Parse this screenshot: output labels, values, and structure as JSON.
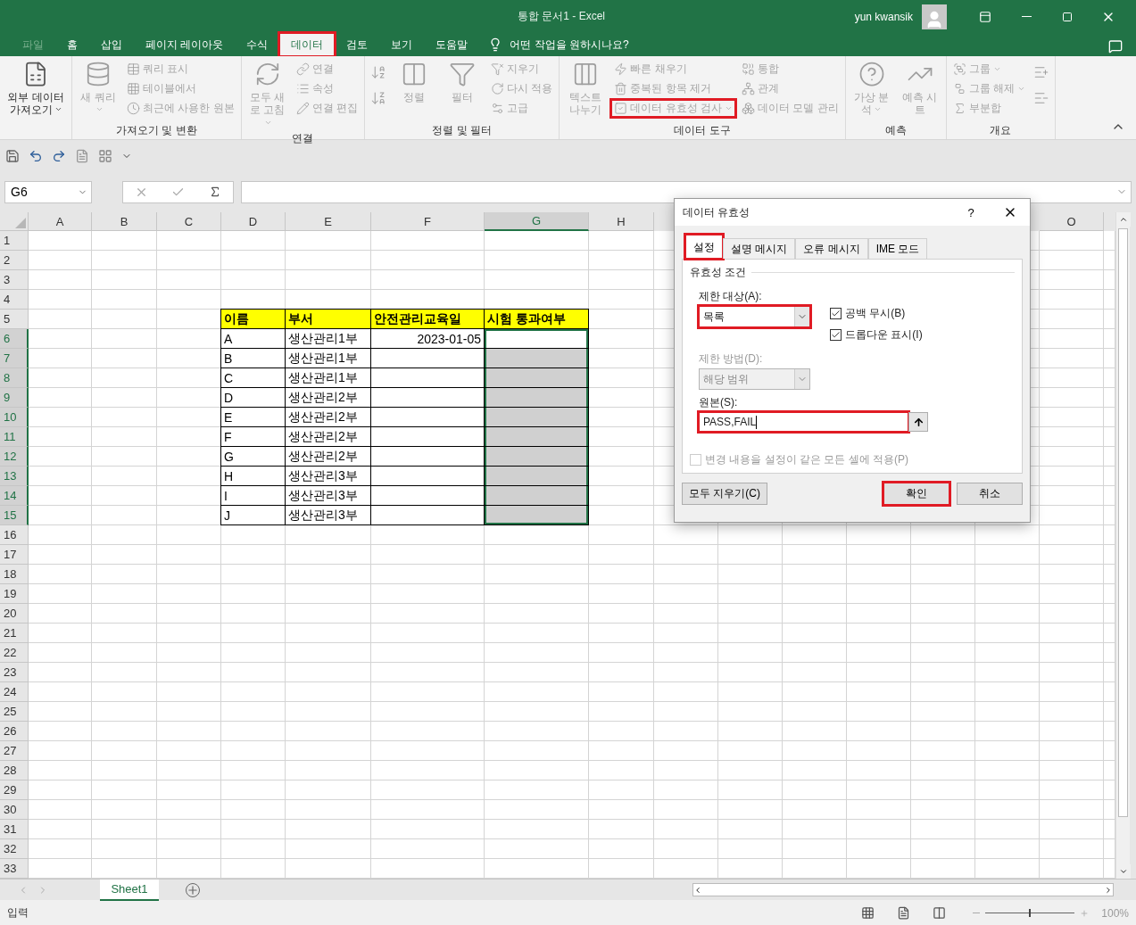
{
  "window": {
    "title": "통합 문서1  -  Excel",
    "user": "yun kwansik"
  },
  "menu_tabs": [
    {
      "label": "파일",
      "kind": "file",
      "selected": false,
      "highlighted": false
    },
    {
      "label": "홈",
      "kind": "tab",
      "selected": false,
      "highlighted": false
    },
    {
      "label": "삽입",
      "kind": "tab",
      "selected": false,
      "highlighted": false
    },
    {
      "label": "페이지 레이아웃",
      "kind": "tab",
      "selected": false,
      "highlighted": false
    },
    {
      "label": "수식",
      "kind": "tab",
      "selected": false,
      "highlighted": false
    },
    {
      "label": "데이터",
      "kind": "tab",
      "selected": true,
      "highlighted": true
    },
    {
      "label": "검토",
      "kind": "tab",
      "selected": false,
      "highlighted": false
    },
    {
      "label": "보기",
      "kind": "tab",
      "selected": false,
      "highlighted": false
    },
    {
      "label": "도움말",
      "kind": "tab",
      "selected": false,
      "highlighted": false
    }
  ],
  "tell_me": {
    "placeholder": "어떤 작업을 원하시나요?"
  },
  "ribbon": {
    "groups": [
      {
        "columns": [
          {
            "kind": "large",
            "label": "외부 데이터 가져오기",
            "disabled": false,
            "dropdown": true,
            "highlighted": false
          }
        ]
      },
      {
        "label": "가져오기 및 변환",
        "columns": [
          {
            "kind": "large",
            "label": "새 쿼리",
            "disabled": true,
            "dropdown": true,
            "highlighted": false
          },
          {
            "kind": "stack",
            "items": [
              {
                "label": "쿼리 표시",
                "disabled": true,
                "dropdown": false,
                "highlighted": false
              },
              {
                "label": "테이블에서",
                "disabled": true,
                "dropdown": false,
                "highlighted": false
              },
              {
                "label": "최근에 사용한 원본",
                "disabled": true,
                "dropdown": false,
                "highlighted": false
              }
            ]
          }
        ]
      },
      {
        "label": "연결",
        "columns": [
          {
            "kind": "large",
            "label": "모두 새로 고침",
            "disabled": true,
            "dropdown": true,
            "highlighted": false
          },
          {
            "kind": "stack",
            "items": [
              {
                "label": "연결",
                "disabled": true,
                "dropdown": false,
                "highlighted": false
              },
              {
                "label": "속성",
                "disabled": true,
                "dropdown": false,
                "highlighted": false
              },
              {
                "label": "연결 편집",
                "disabled": true,
                "dropdown": false,
                "highlighted": false
              }
            ]
          }
        ]
      },
      {
        "label": "정렬 및 필터",
        "columns": [
          {
            "kind": "icons",
            "items": [
              {
                "disabled": true
              },
              {
                "disabled": true
              }
            ]
          },
          {
            "kind": "large",
            "label": "정렬",
            "disabled": true,
            "dropdown": false,
            "highlighted": false
          },
          {
            "kind": "large",
            "label": "필터",
            "disabled": true,
            "dropdown": false,
            "highlighted": false
          },
          {
            "kind": "stack",
            "items": [
              {
                "label": "지우기",
                "disabled": true,
                "dropdown": false,
                "highlighted": false
              },
              {
                "label": "다시 적용",
                "disabled": true,
                "dropdown": false,
                "highlighted": false
              },
              {
                "label": "고급",
                "disabled": true,
                "dropdown": false,
                "highlighted": false
              }
            ]
          }
        ]
      },
      {
        "label": "데이터 도구",
        "columns": [
          {
            "kind": "large",
            "label": "텍스트 나누기",
            "disabled": true,
            "dropdown": false,
            "highlighted": false
          },
          {
            "kind": "stack",
            "items": [
              {
                "label": "빠른 채우기",
                "disabled": true,
                "dropdown": false,
                "highlighted": false
              },
              {
                "label": "중복된 항목 제거",
                "disabled": true,
                "dropdown": false,
                "highlighted": false
              },
              {
                "label": "데이터 유효성 검사",
                "disabled": true,
                "dropdown": true,
                "highlighted": true
              }
            ]
          },
          {
            "kind": "stack",
            "items": [
              {
                "label": "통합",
                "disabled": true,
                "dropdown": false,
                "highlighted": false
              },
              {
                "label": "관계",
                "disabled": true,
                "dropdown": false,
                "highlighted": false
              },
              {
                "label": "데이터 모델 관리",
                "disabled": true,
                "dropdown": false,
                "highlighted": false
              }
            ]
          }
        ]
      },
      {
        "label": "예측",
        "columns": [
          {
            "kind": "large",
            "label": "가상 분석",
            "disabled": true,
            "dropdown": true,
            "highlighted": false
          },
          {
            "kind": "large",
            "label": "예측 시트",
            "disabled": true,
            "dropdown": false,
            "highlighted": false
          }
        ]
      },
      {
        "label": "개요",
        "columns": [
          {
            "kind": "stack",
            "items": [
              {
                "label": "그룹",
                "disabled": true,
                "dropdown": true,
                "highlighted": false
              },
              {
                "label": "그룹 해제",
                "disabled": true,
                "dropdown": true,
                "highlighted": false
              },
              {
                "label": "부분합",
                "disabled": true,
                "dropdown": false,
                "highlighted": false
              }
            ]
          },
          {
            "kind": "icons",
            "items": [
              {
                "disabled": true
              },
              {
                "disabled": true
              }
            ]
          }
        ]
      }
    ]
  },
  "formula_bar": {
    "name_box": "G6"
  },
  "sheet": {
    "columns": [
      "A",
      "B",
      "C",
      "D",
      "E",
      "F",
      "G",
      "H",
      "O"
    ],
    "rows": [
      "1",
      "2",
      "3",
      "4",
      "5",
      "6",
      "7",
      "8",
      "9",
      "10",
      "11",
      "12",
      "13",
      "14",
      "15",
      "16",
      "17",
      "18",
      "19",
      "20",
      "21",
      "22",
      "23",
      "24",
      "25",
      "26",
      "27",
      "28",
      "29",
      "30",
      "31",
      "32",
      "33"
    ]
  },
  "table": {
    "headers": [
      "이름",
      "부서",
      "안전관리교육일",
      "시험 통과여부"
    ],
    "rows": [
      {
        "name": "A",
        "dept": "생산관리1부",
        "date": "2023-01-05",
        "selected": true,
        "active": true
      },
      {
        "name": "B",
        "dept": "생산관리1부",
        "selected": true,
        "active": false
      },
      {
        "name": "C",
        "dept": "생산관리1부",
        "selected": true,
        "active": false
      },
      {
        "name": "D",
        "dept": "생산관리2부",
        "selected": true,
        "active": false
      },
      {
        "name": "E",
        "dept": "생산관리2부",
        "selected": true,
        "active": false
      },
      {
        "name": "F",
        "dept": "생산관리2부",
        "selected": true,
        "active": false
      },
      {
        "name": "G",
        "dept": "생산관리2부",
        "selected": true,
        "active": false
      },
      {
        "name": "H",
        "dept": "생산관리3부",
        "selected": true,
        "active": false
      },
      {
        "name": "I",
        "dept": "생산관리3부",
        "selected": true,
        "active": false
      },
      {
        "name": "J",
        "dept": "생산관리3부",
        "selected": true,
        "active": false
      }
    ]
  },
  "dialog": {
    "title": "데이터 유효성",
    "help": "?",
    "tabs": [
      {
        "label": "설정",
        "selected": true,
        "highlighted": true
      },
      {
        "label": "설명 메시지",
        "selected": false,
        "highlighted": false
      },
      {
        "label": "오류 메시지",
        "selected": false,
        "highlighted": false
      },
      {
        "label": "IME 모드",
        "selected": false,
        "highlighted": false
      }
    ],
    "group_title": "유효성 조건",
    "allow": {
      "label": "제한 대상(A):",
      "value": "목록",
      "disabled": false,
      "highlighted": true
    },
    "data": {
      "label": "제한 방법(D):",
      "value": "해당 범위",
      "disabled": true,
      "highlighted": false
    },
    "options": [
      {
        "label": "공백 무시(B)",
        "checked": true,
        "disabled": false
      },
      {
        "label": "드롭다운 표시(I)",
        "checked": true,
        "disabled": false
      }
    ],
    "source": {
      "label": "원본(S):",
      "value": "PASS,FAIL",
      "highlighted": true
    },
    "apply_all": {
      "label": "변경 내용을 설정이 같은 모든 셀에 적용(P)",
      "checked": false,
      "disabled": true
    },
    "buttons": [
      {
        "label": "모두 지우기(C)",
        "kind": "clear",
        "highlighted": false
      },
      {
        "label": "확인",
        "kind": "ok",
        "highlighted": true
      },
      {
        "label": "취소",
        "kind": "cancel",
        "highlighted": false
      }
    ]
  },
  "sheet_tabs": [
    {
      "label": "Sheet1",
      "selected": true
    }
  ],
  "status_bar": {
    "mode": "입력",
    "zoom_slider": {
      "level": 0.5
    },
    "zoom": "100%"
  }
}
